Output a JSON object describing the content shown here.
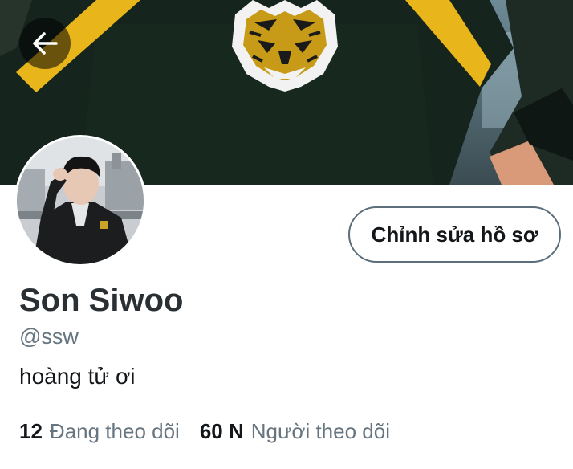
{
  "header": {
    "back_icon": "arrow-left-icon"
  },
  "profile": {
    "display_name": "Son Siwoo",
    "handle": "@ssw",
    "bio": "hoàng tử ơi",
    "edit_button_label": "Chỉnh sửa hồ sơ"
  },
  "stats": {
    "following_count": "12",
    "following_label": "Đang theo dõi",
    "followers_count": "60 N",
    "followers_label": "Người theo dõi"
  },
  "colors": {
    "primary_text": "#14171a",
    "secondary_text": "#66757f",
    "button_border": "#5c6e7a"
  }
}
